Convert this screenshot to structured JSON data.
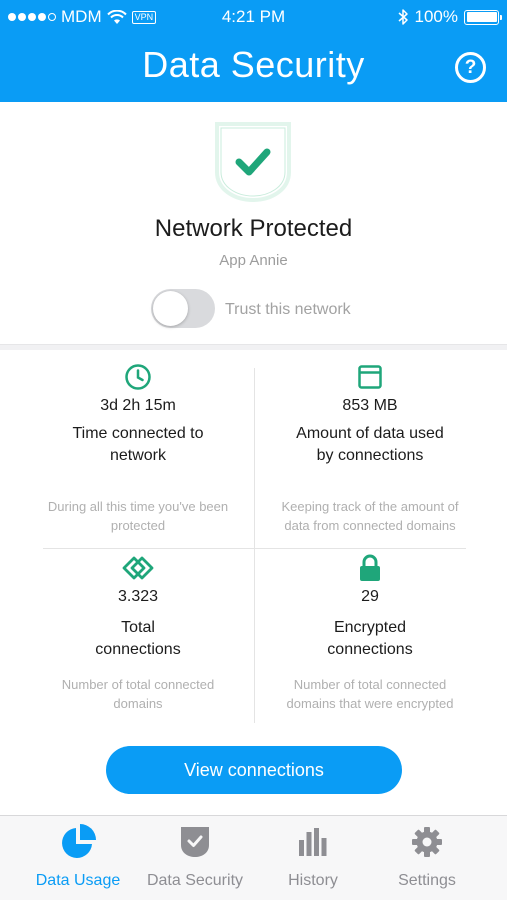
{
  "status_bar": {
    "carrier": "MDM",
    "vpn_badge": "VPN",
    "time": "4:21 PM",
    "battery": "100%"
  },
  "header": {
    "title": "Data Security",
    "help_label": "?"
  },
  "protection": {
    "status": "Network Protected",
    "network_name": "App Annie",
    "trust_label": "Trust this network",
    "trust_enabled": false
  },
  "stats": [
    {
      "icon": "clock-icon",
      "value": "3d 2h 15m",
      "label_line1": "Time connected to",
      "label_line2": "network",
      "desc_line1": "During all this time you've been",
      "desc_line2": "protected"
    },
    {
      "icon": "browser-window-icon",
      "value": "853 MB",
      "label_line1": "Amount of data used",
      "label_line2": "by connections",
      "desc_line1": "Keeping track of the amount of",
      "desc_line2": "data from connected domains"
    },
    {
      "icon": "connections-diamond-icon",
      "value": "3.323",
      "label_line1": "Total",
      "label_line2": "connections",
      "desc_line1": "Number of total connected",
      "desc_line2": "domains"
    },
    {
      "icon": "lock-icon",
      "value": "29",
      "label_line1": "Encrypted",
      "label_line2": "connections",
      "desc_line1": "Number of total connected",
      "desc_line2": "domains that were encrypted"
    }
  ],
  "cta": {
    "label": "View connections"
  },
  "tabs": [
    {
      "label": "Data Usage",
      "icon": "pie-chart-icon",
      "active": true
    },
    {
      "label": "Data Security",
      "icon": "shield-icon",
      "active": false
    },
    {
      "label": "History",
      "icon": "bar-chart-icon",
      "active": false
    },
    {
      "label": "Settings",
      "icon": "gear-icon",
      "active": false
    }
  ],
  "colors": {
    "primary": "#0a9cf5",
    "accent_green": "#1fa67a",
    "muted_text": "#b0b0b0"
  }
}
